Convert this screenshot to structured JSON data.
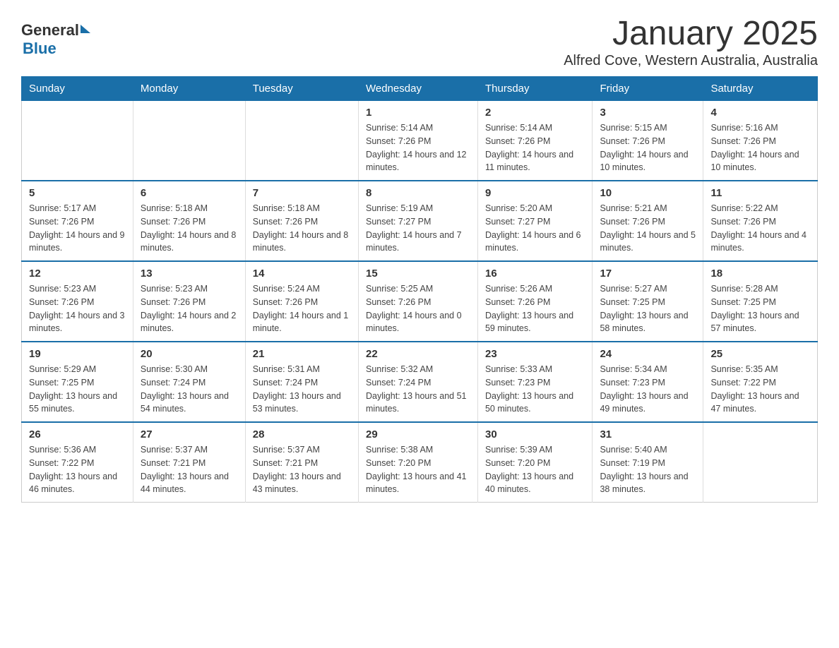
{
  "header": {
    "logo_general": "General",
    "logo_blue": "Blue",
    "title": "January 2025",
    "subtitle": "Alfred Cove, Western Australia, Australia"
  },
  "days_of_week": [
    "Sunday",
    "Monday",
    "Tuesday",
    "Wednesday",
    "Thursday",
    "Friday",
    "Saturday"
  ],
  "weeks": [
    {
      "cells": [
        {
          "day": "",
          "info": ""
        },
        {
          "day": "",
          "info": ""
        },
        {
          "day": "",
          "info": ""
        },
        {
          "day": "1",
          "info": "Sunrise: 5:14 AM\nSunset: 7:26 PM\nDaylight: 14 hours and 12 minutes."
        },
        {
          "day": "2",
          "info": "Sunrise: 5:14 AM\nSunset: 7:26 PM\nDaylight: 14 hours and 11 minutes."
        },
        {
          "day": "3",
          "info": "Sunrise: 5:15 AM\nSunset: 7:26 PM\nDaylight: 14 hours and 10 minutes."
        },
        {
          "day": "4",
          "info": "Sunrise: 5:16 AM\nSunset: 7:26 PM\nDaylight: 14 hours and 10 minutes."
        }
      ]
    },
    {
      "cells": [
        {
          "day": "5",
          "info": "Sunrise: 5:17 AM\nSunset: 7:26 PM\nDaylight: 14 hours and 9 minutes."
        },
        {
          "day": "6",
          "info": "Sunrise: 5:18 AM\nSunset: 7:26 PM\nDaylight: 14 hours and 8 minutes."
        },
        {
          "day": "7",
          "info": "Sunrise: 5:18 AM\nSunset: 7:26 PM\nDaylight: 14 hours and 8 minutes."
        },
        {
          "day": "8",
          "info": "Sunrise: 5:19 AM\nSunset: 7:27 PM\nDaylight: 14 hours and 7 minutes."
        },
        {
          "day": "9",
          "info": "Sunrise: 5:20 AM\nSunset: 7:27 PM\nDaylight: 14 hours and 6 minutes."
        },
        {
          "day": "10",
          "info": "Sunrise: 5:21 AM\nSunset: 7:26 PM\nDaylight: 14 hours and 5 minutes."
        },
        {
          "day": "11",
          "info": "Sunrise: 5:22 AM\nSunset: 7:26 PM\nDaylight: 14 hours and 4 minutes."
        }
      ]
    },
    {
      "cells": [
        {
          "day": "12",
          "info": "Sunrise: 5:23 AM\nSunset: 7:26 PM\nDaylight: 14 hours and 3 minutes."
        },
        {
          "day": "13",
          "info": "Sunrise: 5:23 AM\nSunset: 7:26 PM\nDaylight: 14 hours and 2 minutes."
        },
        {
          "day": "14",
          "info": "Sunrise: 5:24 AM\nSunset: 7:26 PM\nDaylight: 14 hours and 1 minute."
        },
        {
          "day": "15",
          "info": "Sunrise: 5:25 AM\nSunset: 7:26 PM\nDaylight: 14 hours and 0 minutes."
        },
        {
          "day": "16",
          "info": "Sunrise: 5:26 AM\nSunset: 7:26 PM\nDaylight: 13 hours and 59 minutes."
        },
        {
          "day": "17",
          "info": "Sunrise: 5:27 AM\nSunset: 7:25 PM\nDaylight: 13 hours and 58 minutes."
        },
        {
          "day": "18",
          "info": "Sunrise: 5:28 AM\nSunset: 7:25 PM\nDaylight: 13 hours and 57 minutes."
        }
      ]
    },
    {
      "cells": [
        {
          "day": "19",
          "info": "Sunrise: 5:29 AM\nSunset: 7:25 PM\nDaylight: 13 hours and 55 minutes."
        },
        {
          "day": "20",
          "info": "Sunrise: 5:30 AM\nSunset: 7:24 PM\nDaylight: 13 hours and 54 minutes."
        },
        {
          "day": "21",
          "info": "Sunrise: 5:31 AM\nSunset: 7:24 PM\nDaylight: 13 hours and 53 minutes."
        },
        {
          "day": "22",
          "info": "Sunrise: 5:32 AM\nSunset: 7:24 PM\nDaylight: 13 hours and 51 minutes."
        },
        {
          "day": "23",
          "info": "Sunrise: 5:33 AM\nSunset: 7:23 PM\nDaylight: 13 hours and 50 minutes."
        },
        {
          "day": "24",
          "info": "Sunrise: 5:34 AM\nSunset: 7:23 PM\nDaylight: 13 hours and 49 minutes."
        },
        {
          "day": "25",
          "info": "Sunrise: 5:35 AM\nSunset: 7:22 PM\nDaylight: 13 hours and 47 minutes."
        }
      ]
    },
    {
      "cells": [
        {
          "day": "26",
          "info": "Sunrise: 5:36 AM\nSunset: 7:22 PM\nDaylight: 13 hours and 46 minutes."
        },
        {
          "day": "27",
          "info": "Sunrise: 5:37 AM\nSunset: 7:21 PM\nDaylight: 13 hours and 44 minutes."
        },
        {
          "day": "28",
          "info": "Sunrise: 5:37 AM\nSunset: 7:21 PM\nDaylight: 13 hours and 43 minutes."
        },
        {
          "day": "29",
          "info": "Sunrise: 5:38 AM\nSunset: 7:20 PM\nDaylight: 13 hours and 41 minutes."
        },
        {
          "day": "30",
          "info": "Sunrise: 5:39 AM\nSunset: 7:20 PM\nDaylight: 13 hours and 40 minutes."
        },
        {
          "day": "31",
          "info": "Sunrise: 5:40 AM\nSunset: 7:19 PM\nDaylight: 13 hours and 38 minutes."
        },
        {
          "day": "",
          "info": ""
        }
      ]
    }
  ]
}
